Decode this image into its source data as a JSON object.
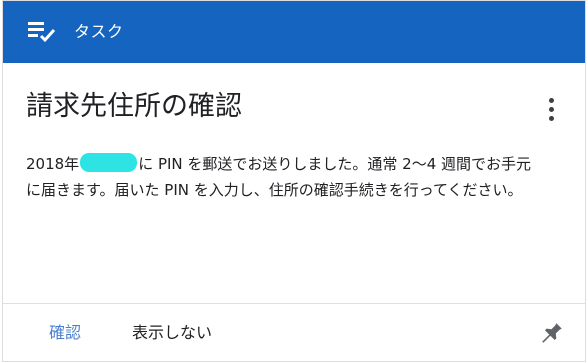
{
  "header": {
    "icon": "task-checklist-icon",
    "label": "タスク",
    "color": "#1565c0"
  },
  "card": {
    "title": "請求先住所の確認",
    "more_icon": "more-vert-icon",
    "body": {
      "line1_prefix": "2018年",
      "line1_suffix": "に PIN を郵送でお送りしました。通常 2～4 週間でお手元",
      "line2": "に届きます。届いた PIN を入力し、住所の確認手続きを行ってください。"
    }
  },
  "actions": {
    "confirm_label": "確認",
    "hide_label": "表示しない",
    "pin_icon": "pin-icon"
  }
}
